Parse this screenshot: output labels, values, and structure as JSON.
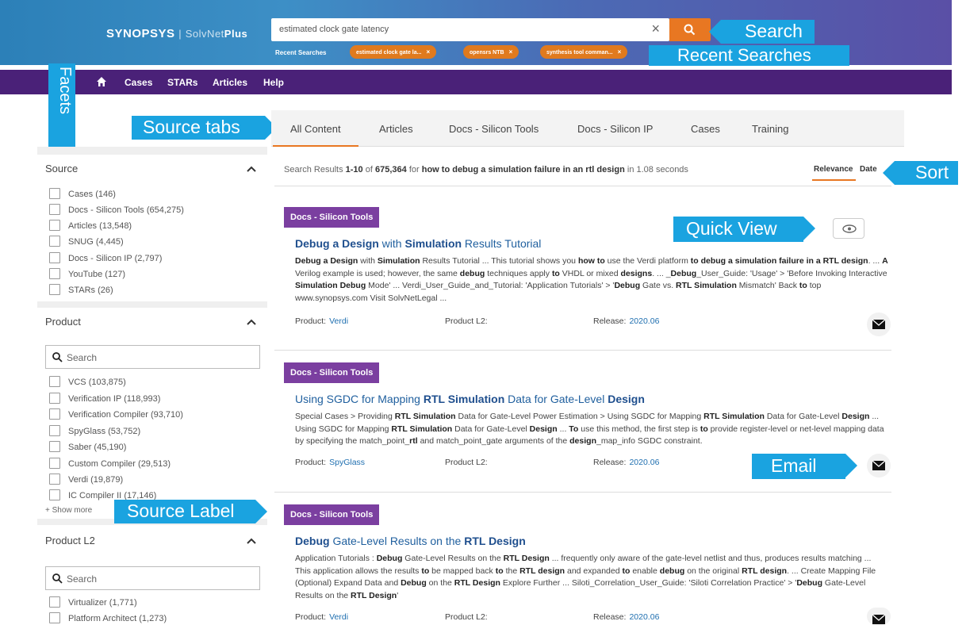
{
  "header": {
    "brand": "SYNOPSYS",
    "product": "SolvNet",
    "product_plus": "Plus",
    "search_value": "estimated clock gate latency",
    "recent_label": "Recent Searches",
    "recent": [
      "estimated clock gate la...",
      "opensrs NTB",
      "synthesis tool comman..."
    ]
  },
  "nav": {
    "items": [
      "Cases",
      "STARs",
      "Articles",
      "Help"
    ]
  },
  "callouts": {
    "search": "Search",
    "recent": "Recent Searches",
    "facets": "Facets",
    "source_tabs": "Source tabs",
    "sort": "Sort",
    "quick_view": "Quick View",
    "email": "Email",
    "source_label": "Source Label"
  },
  "tabs": [
    "All Content",
    "Articles",
    "Docs - Silicon Tools",
    "Docs - Silicon IP",
    "Cases",
    "Training"
  ],
  "sidebar": {
    "source": {
      "title": "Source",
      "items": [
        {
          "label": "Cases",
          "count": "(146)"
        },
        {
          "label": "Docs - Silicon Tools",
          "count": "(654,275)"
        },
        {
          "label": "Articles",
          "count": "(13,548)"
        },
        {
          "label": "SNUG",
          "count": "(4,445)"
        },
        {
          "label": "Docs - Silicon IP",
          "count": "(2,797)"
        },
        {
          "label": "YouTube",
          "count": "(127)"
        },
        {
          "label": "STARs",
          "count": "(26)"
        }
      ]
    },
    "product": {
      "title": "Product",
      "search_placeholder": "Search",
      "items": [
        {
          "label": "VCS",
          "count": "(103,875)"
        },
        {
          "label": "Verification IP",
          "count": "(118,993)"
        },
        {
          "label": "Verification Compiler",
          "count": "(93,710)"
        },
        {
          "label": "SpyGlass",
          "count": "(53,752)"
        },
        {
          "label": "Saber",
          "count": "(45,190)"
        },
        {
          "label": "Custom Compiler",
          "count": "(29,513)"
        },
        {
          "label": "Verdi",
          "count": "(19,879)"
        },
        {
          "label": "IC Compiler II",
          "count": "(17,146)"
        }
      ],
      "show_more": "+ Show more"
    },
    "product_l2": {
      "title": "Product L2",
      "search_placeholder": "Search",
      "items": [
        {
          "label": "Virtualizer",
          "count": "(1,771)"
        },
        {
          "label": "Platform Architect",
          "count": "(1,273)"
        }
      ]
    }
  },
  "results_summary": {
    "prefix": "Search Results",
    "range": "1-10",
    "of": "of",
    "total": "675,364",
    "for": "for",
    "query": "how to debug a simulation failure in an rtl design",
    "time": "in 1.08 seconds"
  },
  "sort": {
    "relevance": "Relevance",
    "date": "Date"
  },
  "meta_labels": {
    "product": "Product:",
    "product_l2": "Product L2:",
    "release": "Release:"
  },
  "results": [
    {
      "badge": "Docs - Silicon Tools",
      "title_parts": [
        {
          "t": "Debug a Design",
          "b": true
        },
        {
          "t": " with ",
          "b": false
        },
        {
          "t": "Simulation",
          "b": true
        },
        {
          "t": " Results Tutorial",
          "b": false
        }
      ],
      "desc_parts": [
        {
          "t": "Debug a Design",
          "b": true
        },
        {
          "t": " with ",
          "b": false
        },
        {
          "t": "Simulation",
          "b": true
        },
        {
          "t": " Results Tutorial ... This tutorial shows you ",
          "b": false
        },
        {
          "t": "how to",
          "b": true
        },
        {
          "t": " use the Verdi platform ",
          "b": false
        },
        {
          "t": "to debug a simulation failure in a RTL design",
          "b": true
        },
        {
          "t": ". ... ",
          "b": false
        },
        {
          "t": "A",
          "b": true
        },
        {
          "t": " Verilog example is used; however, the same ",
          "b": false
        },
        {
          "t": "debug",
          "b": true
        },
        {
          "t": " techniques apply ",
          "b": false
        },
        {
          "t": "to",
          "b": true
        },
        {
          "t": " VHDL or mixed ",
          "b": false
        },
        {
          "t": "designs",
          "b": true
        },
        {
          "t": ". ... _",
          "b": false
        },
        {
          "t": "Debug",
          "b": true
        },
        {
          "t": "_User_Guide: 'Usage' > 'Before Invoking Interactive ",
          "b": false
        },
        {
          "t": "Simulation Debug",
          "b": true
        },
        {
          "t": " Mode' ... Verdi_User_Guide_and_Tutorial: 'Application Tutorials' > '",
          "b": false
        },
        {
          "t": "Debug",
          "b": true
        },
        {
          "t": " Gate vs. ",
          "b": false
        },
        {
          "t": "RTL Simulation",
          "b": true
        },
        {
          "t": " Mismatch' Back ",
          "b": false
        },
        {
          "t": "to",
          "b": true
        },
        {
          "t": " top www.synopsys.com Visit SolvNetLegal ...",
          "b": false
        }
      ],
      "product": "Verdi",
      "product_l2": "",
      "release": "2020.06"
    },
    {
      "badge": "Docs - Silicon Tools",
      "title_parts": [
        {
          "t": "Using SGDC for Mapping ",
          "b": false
        },
        {
          "t": "RTL Simulation",
          "b": true
        },
        {
          "t": " Data for Gate-Level ",
          "b": false
        },
        {
          "t": "Design",
          "b": true
        }
      ],
      "desc_parts": [
        {
          "t": "Special Cases > Providing ",
          "b": false
        },
        {
          "t": "RTL Simulation",
          "b": true
        },
        {
          "t": " Data for Gate-Level Power Estimation > Using SGDC for Mapping ",
          "b": false
        },
        {
          "t": "RTL Simulation",
          "b": true
        },
        {
          "t": " Data for Gate-Level ",
          "b": false
        },
        {
          "t": "Design",
          "b": true
        },
        {
          "t": " ... Using SGDC for Mapping ",
          "b": false
        },
        {
          "t": "RTL Simulation",
          "b": true
        },
        {
          "t": " Data for Gate-Level ",
          "b": false
        },
        {
          "t": "Design",
          "b": true
        },
        {
          "t": " ... ",
          "b": false
        },
        {
          "t": "To",
          "b": true
        },
        {
          "t": " use this method, the first step is ",
          "b": false
        },
        {
          "t": "to",
          "b": true
        },
        {
          "t": " provide register-level or net-level mapping data by specifying the match_point_",
          "b": false
        },
        {
          "t": "rtl",
          "b": true
        },
        {
          "t": " and match_point_gate arguments of the ",
          "b": false
        },
        {
          "t": "design",
          "b": true
        },
        {
          "t": "_map_info SGDC constraint.",
          "b": false
        }
      ],
      "product": "SpyGlass",
      "product_l2": "",
      "release": "2020.06"
    },
    {
      "badge": "Docs - Silicon Tools",
      "title_parts": [
        {
          "t": "Debug",
          "b": true
        },
        {
          "t": " Gate-Level Results on the ",
          "b": false
        },
        {
          "t": "RTL Design",
          "b": true
        }
      ],
      "desc_parts": [
        {
          "t": "Application Tutorials : ",
          "b": false
        },
        {
          "t": "Debug",
          "b": true
        },
        {
          "t": " Gate-Level Results on the ",
          "b": false
        },
        {
          "t": "RTL Design",
          "b": true
        },
        {
          "t": " ... frequently only aware of the gate-level netlist and thus, produces results matching ... This application allows the results ",
          "b": false
        },
        {
          "t": "to",
          "b": true
        },
        {
          "t": " be mapped back ",
          "b": false
        },
        {
          "t": "to",
          "b": true
        },
        {
          "t": " the ",
          "b": false
        },
        {
          "t": "RTL design",
          "b": true
        },
        {
          "t": " and expanded ",
          "b": false
        },
        {
          "t": "to",
          "b": true
        },
        {
          "t": " enable ",
          "b": false
        },
        {
          "t": "debug",
          "b": true
        },
        {
          "t": " on the original ",
          "b": false
        },
        {
          "t": "RTL design",
          "b": true
        },
        {
          "t": ". ... Create Mapping File (Optional) Expand Data and ",
          "b": false
        },
        {
          "t": "Debug",
          "b": true
        },
        {
          "t": " on the ",
          "b": false
        },
        {
          "t": "RTL Design",
          "b": true
        },
        {
          "t": " Explore Further ... Siloti_Correlation_User_Guide: 'Siloti Correlation Practice' > '",
          "b": false
        },
        {
          "t": "Debug",
          "b": true
        },
        {
          "t": " Gate-Level Results on the ",
          "b": false
        },
        {
          "t": "RTL Design",
          "b": true
        },
        {
          "t": "'",
          "b": false
        }
      ],
      "product": "Verdi",
      "product_l2": "",
      "release": "2020.06"
    }
  ],
  "colors": {
    "accent": "#e87722",
    "nav": "#4a2178",
    "badge": "#7b3fa0",
    "callout": "#1aa3e0",
    "link": "#1f5f9e"
  }
}
